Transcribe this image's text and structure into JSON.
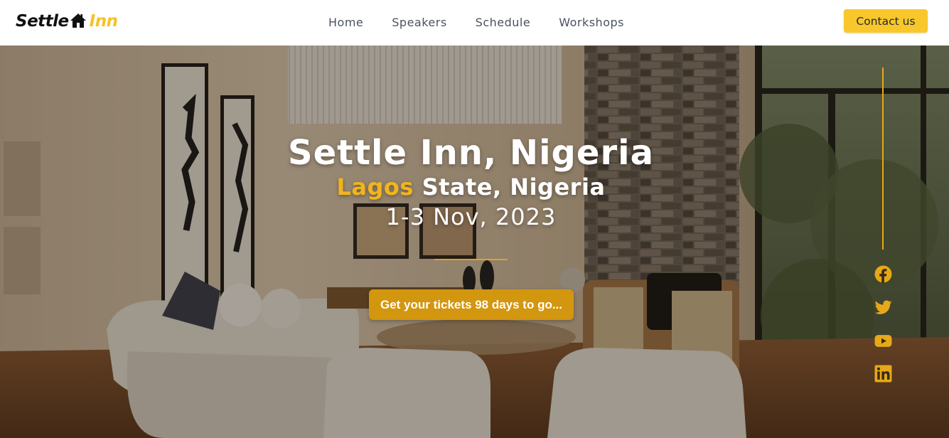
{
  "brand": {
    "name_part1": "Settle",
    "name_part2": "Inn",
    "icon": "house-icon",
    "accent_color": "#f6c324"
  },
  "nav": {
    "links": [
      {
        "label": "Home"
      },
      {
        "label": "Speakers"
      },
      {
        "label": "Schedule"
      },
      {
        "label": "Workshops"
      }
    ],
    "contact_label": "Contact us"
  },
  "hero": {
    "title": "Settle Inn, Nigeria",
    "subtitle_accent": "Lagos",
    "subtitle_rest": " State, Nigeria",
    "date": "1-3 Nov, 2023",
    "cta_label": "Get your tickets 98 days to go...",
    "accent_color": "#d3960f"
  },
  "social": {
    "icons": [
      "facebook-icon",
      "twitter-icon",
      "youtube-icon",
      "linkedin-icon"
    ],
    "color": "#e6a818"
  }
}
